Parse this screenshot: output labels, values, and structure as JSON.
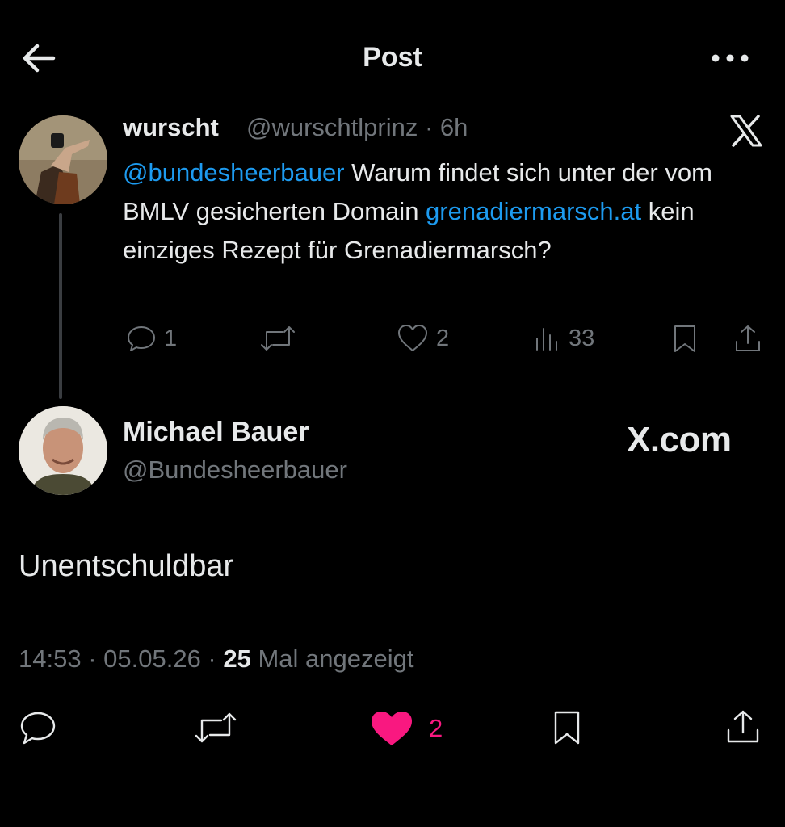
{
  "header": {
    "title": "Post"
  },
  "parent_tweet": {
    "display_name": "wurscht",
    "handle_time": "@wurschtlprinz · 6h",
    "mention": "@bundesheerbauer",
    "text_part1": " Warum findet sich unter der vom BMLV gesicherten Domain ",
    "link": "grenadiermarsch.at",
    "text_part2": " kein einziges Rezept für Grenadiermarsch?",
    "replies": "1",
    "likes": "2",
    "views": "33"
  },
  "author": {
    "display_name": "Michael Bauer",
    "handle": "@Bundesheerbauer",
    "watermark": "X.com"
  },
  "post": {
    "text": "Unentschuldbar",
    "time": "14:53",
    "date": "05.05.26",
    "views": "25",
    "views_label": "Mal angezeigt",
    "likes": "2"
  },
  "colors": {
    "background": "#000000",
    "text": "#e7e9ea",
    "muted": "#71767b",
    "link": "#1d9bf0",
    "like": "#f91880"
  },
  "icons": [
    "back-arrow-icon",
    "more-icon",
    "x-logo-icon",
    "reply-icon",
    "retweet-icon",
    "like-icon",
    "views-icon",
    "bookmark-icon",
    "share-icon"
  ]
}
